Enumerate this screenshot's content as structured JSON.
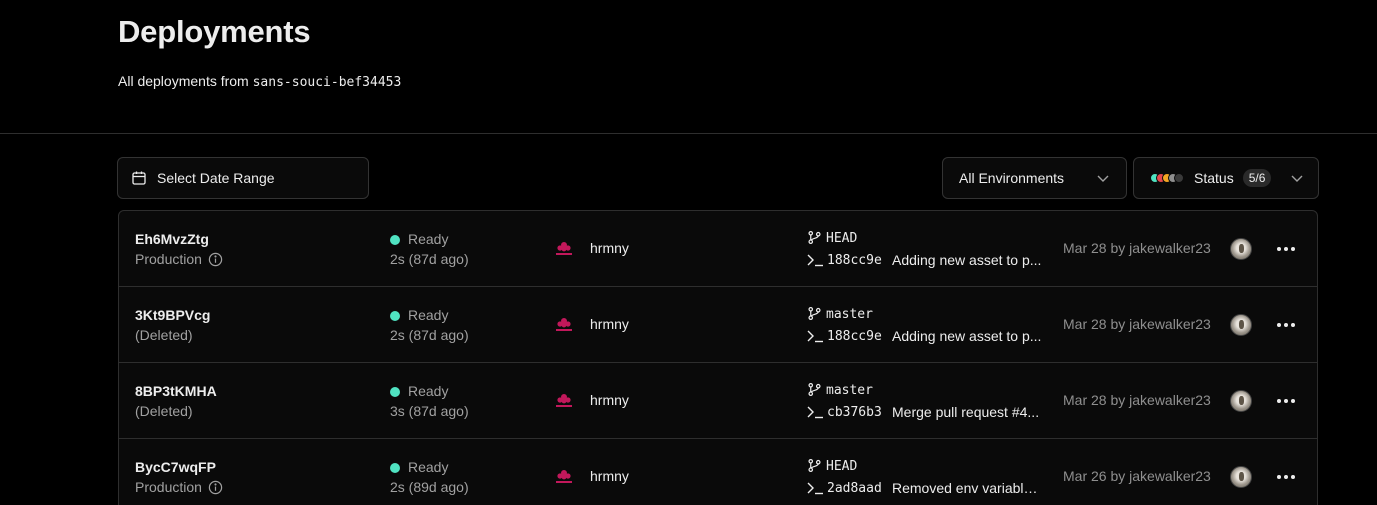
{
  "header": {
    "title": "Deployments",
    "subtitle_prefix": "All deployments from ",
    "project_slug": "sans-souci-bef34453"
  },
  "filters": {
    "date_range_label": "Select Date Range",
    "environment_label": "All Environments",
    "status_label": "Status",
    "status_count": "5/6",
    "status_dot_colors": [
      "#50e3c2",
      "#e5484d",
      "#f5a623",
      "#8f8f8f",
      "#3a3a3a"
    ]
  },
  "colors": {
    "ready": "#50e3c2",
    "project_logo": "#c2185b"
  },
  "rows": [
    {
      "id": "Eh6MvzZtg",
      "environment": "Production",
      "env_info_icon": true,
      "status": "Ready",
      "duration": "2s (87d ago)",
      "project": "hrmny",
      "branch": "HEAD",
      "commit_hash": "188cc9e",
      "commit_message": "Adding new asset to p...",
      "when": "Mar 28 by jakewalker23"
    },
    {
      "id": "3Kt9BPVcg",
      "environment": "(Deleted)",
      "env_info_icon": false,
      "status": "Ready",
      "duration": "2s (87d ago)",
      "project": "hrmny",
      "branch": "master",
      "commit_hash": "188cc9e",
      "commit_message": "Adding new asset to p...",
      "when": "Mar 28 by jakewalker23"
    },
    {
      "id": "8BP3tKMHA",
      "environment": "(Deleted)",
      "env_info_icon": false,
      "status": "Ready",
      "duration": "3s (87d ago)",
      "project": "hrmny",
      "branch": "master",
      "commit_hash": "cb376b3",
      "commit_message": "Merge pull request #4...",
      "when": "Mar 28 by jakewalker23"
    },
    {
      "id": "BycC7wqFP",
      "environment": "Production",
      "env_info_icon": true,
      "status": "Ready",
      "duration": "2s (89d ago)",
      "project": "hrmny",
      "branch": "HEAD",
      "commit_hash": "2ad8aad",
      "commit_message": "Removed env variable ...",
      "when": "Mar 26 by jakewalker23"
    }
  ]
}
